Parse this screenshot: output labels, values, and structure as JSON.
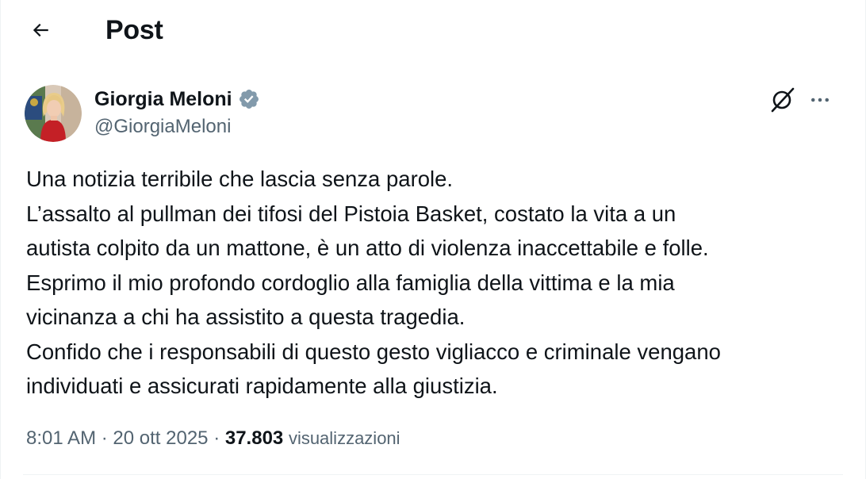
{
  "header": {
    "title": "Post",
    "back_icon": "arrow-left-icon"
  },
  "post": {
    "author": {
      "display_name": "Giorgia Meloni",
      "handle": "@GiorgiaMeloni",
      "verified_icon": "verified-badge-icon",
      "verified_color": "#829aab",
      "avatar_icon": "avatar-photo"
    },
    "actions": {
      "grok_icon": "grok-icon",
      "more_icon": "more-options-icon"
    },
    "text_lines": [
      "Una notizia terribile che lascia senza parole.",
      "L’assalto al pullman dei tifosi del Pistoia Basket, costato la vita a un",
      "autista colpito da un mattone, è un atto di violenza inaccettabile e folle.",
      "Esprimo il mio profondo cordoglio alla famiglia della vittima e la mia",
      "vicinanza a chi ha assistito a questa tragedia.",
      "Confido che i responsabili di questo gesto vigliacco e criminale vengano",
      "individuati e assicurati rapidamente alla giustizia."
    ],
    "meta": {
      "time": "8:01 AM",
      "separator": "·",
      "date": "20 ott 2025",
      "views_count": "37.803",
      "views_label": "visualizzazioni"
    }
  },
  "colors": {
    "text_primary": "#0f1419",
    "text_secondary": "#536471",
    "divider": "#eff3f4"
  }
}
